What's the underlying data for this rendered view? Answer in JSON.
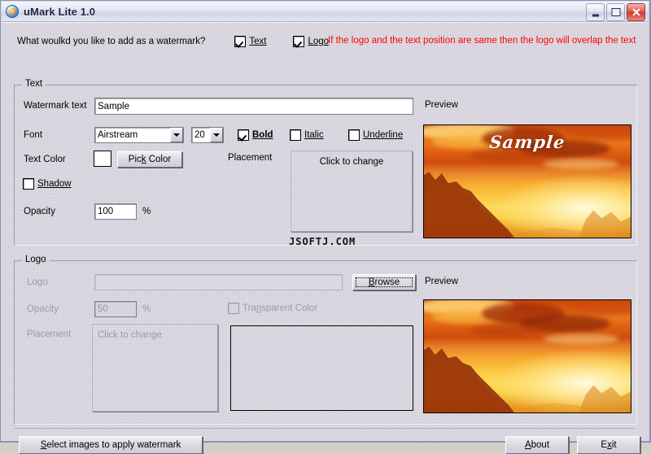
{
  "window": {
    "title": "uMark Lite 1.0",
    "icon": "app-globe-icon",
    "buttons": {
      "minimize": "_",
      "maximize": "□",
      "close": "✕"
    }
  },
  "header": {
    "question": "What woulkd you like to add as a watermark?",
    "text_checkbox": {
      "label": "Text",
      "checked": true
    },
    "logo_checkbox": {
      "label": "Logo",
      "checked": true
    },
    "warning": "If the logo and the text position are same then the logo will overlap the text",
    "warning_color": "#ff0000"
  },
  "text_group": {
    "title": "Text",
    "watermark_label": "Watermark text",
    "watermark_value": "Sample",
    "font_label": "Font",
    "font_value": "Airstream",
    "font_size_value": "20",
    "bold": {
      "label": "Bold",
      "checked": true
    },
    "italic": {
      "label": "Italic",
      "checked": false
    },
    "underline": {
      "label": "Underline",
      "checked": false
    },
    "text_color_label": "Text Color",
    "text_color_value": "#ffffff",
    "pick_color_button": "Pick Color",
    "shadow": {
      "label": "Shadow",
      "checked": false
    },
    "opacity_label": "Opacity",
    "opacity_value": "100",
    "percent": "%",
    "placement_label": "Placement",
    "placement_value": "Click to change",
    "preview_label": "Preview",
    "preview_watermark_text": "Sample"
  },
  "logo_group": {
    "title": "Logo",
    "logo_label": "Logo",
    "logo_value": "",
    "browse_button": "Browse",
    "opacity_label": "Opacity",
    "opacity_value": "50",
    "percent": "%",
    "transparent_color": {
      "label": "Transparent Color",
      "checked": false
    },
    "placement_label": "Placement",
    "placement_value": "Click to change",
    "preview_label": "Preview",
    "disabled": true
  },
  "footer": {
    "select_images_button": "Select images to apply watermark",
    "about_button": "About",
    "exit_button": "Exit"
  },
  "overlay": {
    "site_watermark": "JSOFTJ.COM"
  }
}
